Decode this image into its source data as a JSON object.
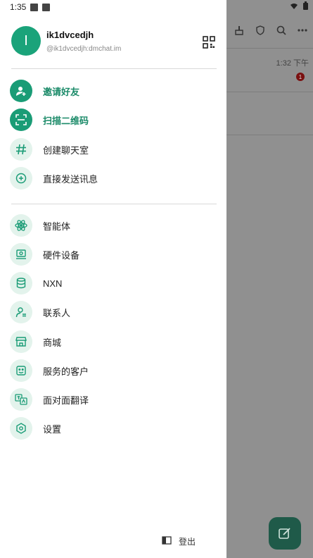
{
  "status": {
    "time": "1:35"
  },
  "background": {
    "chat_time": "1:32 下午",
    "unread_badge": "1"
  },
  "profile": {
    "avatar_letter": "I",
    "name": "ik1dvcedjh",
    "id": "@ik1dvcedjh:dmchat.im"
  },
  "menu_primary": [
    {
      "label": "邀请好友",
      "icon": "add-user-icon"
    },
    {
      "label": "扫描二维码",
      "icon": "scan-icon"
    },
    {
      "label": "创建聊天室",
      "icon": "hash-icon"
    },
    {
      "label": "直接发送讯息",
      "icon": "plus-circle-icon"
    }
  ],
  "menu_secondary": [
    {
      "label": "智能体",
      "icon": "atom-icon"
    },
    {
      "label": "硬件设备",
      "icon": "device-icon"
    },
    {
      "label": "NXN",
      "icon": "database-icon"
    },
    {
      "label": "联系人",
      "icon": "contact-icon"
    },
    {
      "label": "商城",
      "icon": "store-icon"
    },
    {
      "label": "服务的客户",
      "icon": "customer-icon"
    },
    {
      "label": "面对面翻译",
      "icon": "translate-icon"
    },
    {
      "label": "设置",
      "icon": "settings-icon"
    }
  ],
  "logout_label": "登出",
  "colors": {
    "accent": "#1a9c76",
    "accent_soft": "#e3f3ec"
  }
}
